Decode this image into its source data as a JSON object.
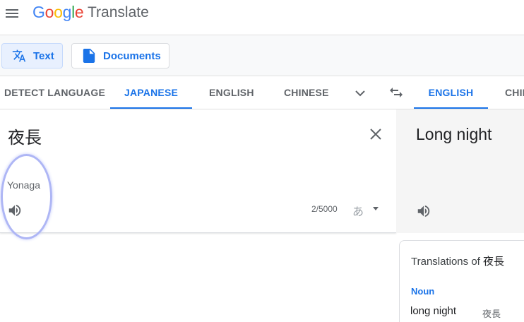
{
  "header": {
    "logo_letters": [
      "G",
      "o",
      "o",
      "g",
      "l",
      "e"
    ],
    "product": "Translate"
  },
  "modes": {
    "text_label": "Text",
    "documents_label": "Documents"
  },
  "language_bar": {
    "source_tabs": [
      "DETECT LANGUAGE",
      "JAPANESE",
      "ENGLISH",
      "CHINESE"
    ],
    "source_active": "JAPANESE",
    "target_tabs": [
      "ENGLISH",
      "CHIN"
    ],
    "target_active": "ENGLISH"
  },
  "source": {
    "text": "夜長",
    "romanization": "Yonaga",
    "char_count": "2/5000",
    "ime_label": "あ"
  },
  "target": {
    "text": "Long night"
  },
  "translations_card": {
    "title_prefix": "Translations of ",
    "title_word": "夜長",
    "part_of_speech": "Noun",
    "entries": [
      {
        "translation": "long night",
        "source": "夜長"
      }
    ]
  },
  "colors": {
    "accent": "#1a73e8",
    "highlight_ring": "#aeb6f5",
    "target_bg": "#f5f5f5"
  },
  "icons": [
    "menu-icon",
    "translate-icon",
    "document-icon",
    "chevron-down-icon",
    "swap-icon",
    "close-icon",
    "speaker-icon",
    "dropdown-caret-icon"
  ]
}
